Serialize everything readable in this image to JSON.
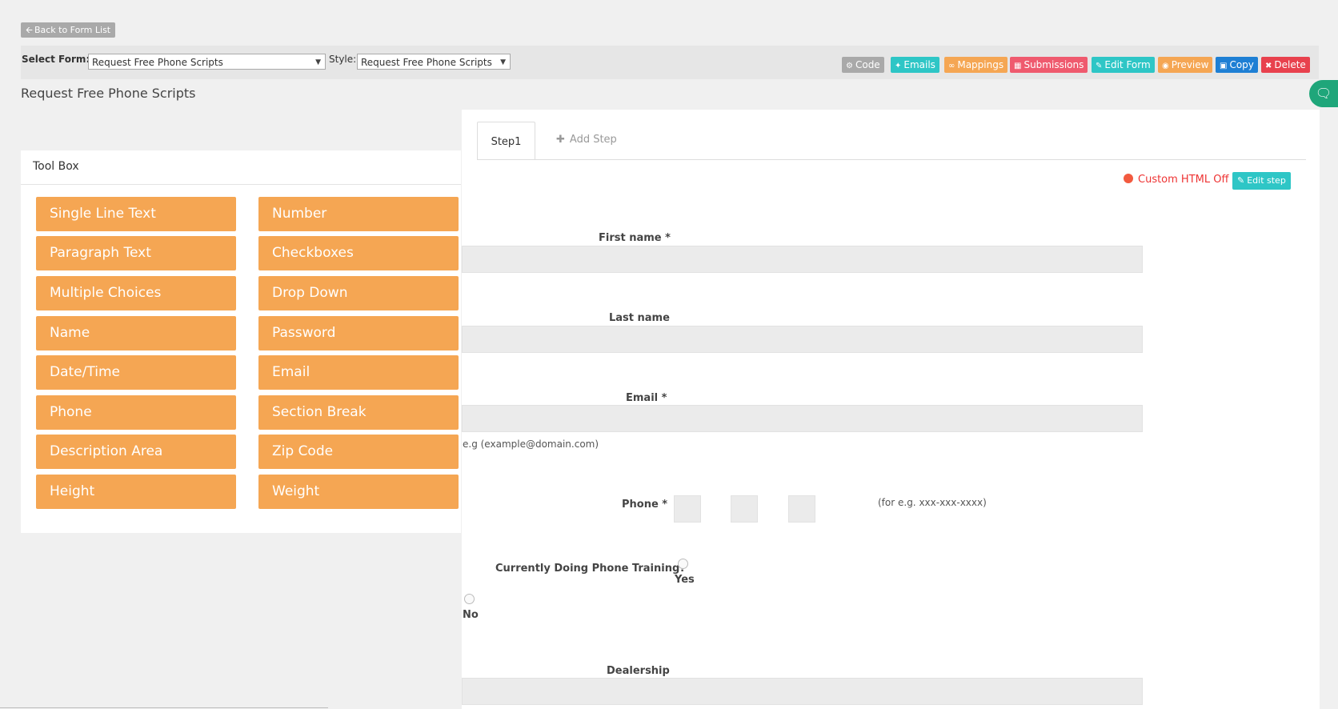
{
  "top": {
    "back_label": "Back to Form List"
  },
  "select_bar": {
    "select_form_label": "Select Form:",
    "select_form_value": "Request Free Phone Scripts",
    "style_label": "Style:",
    "style_value": "Request Free Phone Scripts"
  },
  "actions": [
    {
      "label": "Code",
      "icon": "gears-icon",
      "color": "#a9a9a9"
    },
    {
      "label": "Emails",
      "icon": "twitter-icon",
      "color": "#2ec6c6"
    },
    {
      "label": "Mappings",
      "icon": "link-icon",
      "color": "#f5a653"
    },
    {
      "label": "Submissions",
      "icon": "table-icon",
      "color": "#ef5a6e"
    },
    {
      "label": "Edit Form",
      "icon": "pencil-icon",
      "color": "#2ec6c6"
    },
    {
      "label": "Preview",
      "icon": "eye-icon",
      "color": "#f5a653"
    },
    {
      "label": "Copy",
      "icon": "file-icon",
      "color": "#1e7fd4"
    },
    {
      "label": "Delete",
      "icon": "close-icon",
      "color": "#e8414d"
    }
  ],
  "page_title": "Request Free Phone Scripts",
  "toolbox": {
    "title": "Tool Box",
    "items": [
      "Single Line Text",
      "Number",
      "Paragraph Text",
      "Checkboxes",
      "Multiple Choices",
      "Drop Down",
      "Name",
      "Password",
      "Date/Time",
      "Email",
      "Phone",
      "Section Break",
      "Description Area",
      "Zip Code",
      "Height",
      "Weight"
    ],
    "button_color": "#f5a653"
  },
  "steps": {
    "active": "Step1",
    "add_label": "Add Step"
  },
  "step_controls": {
    "custom_html": "Custom HTML Off",
    "edit_step": "Edit step"
  },
  "form": {
    "first_name_label": "First name *",
    "last_name_label": "Last name",
    "email_label": "Email *",
    "email_hint": "e.g (example@domain.com)",
    "phone_label": "Phone *",
    "phone_hint": "(for e.g. xxx-xxx-xxxx)",
    "training_label": "Currently Doing Phone Training?",
    "training_yes": "Yes",
    "training_no": "No",
    "dealership_label": "Dealership"
  }
}
